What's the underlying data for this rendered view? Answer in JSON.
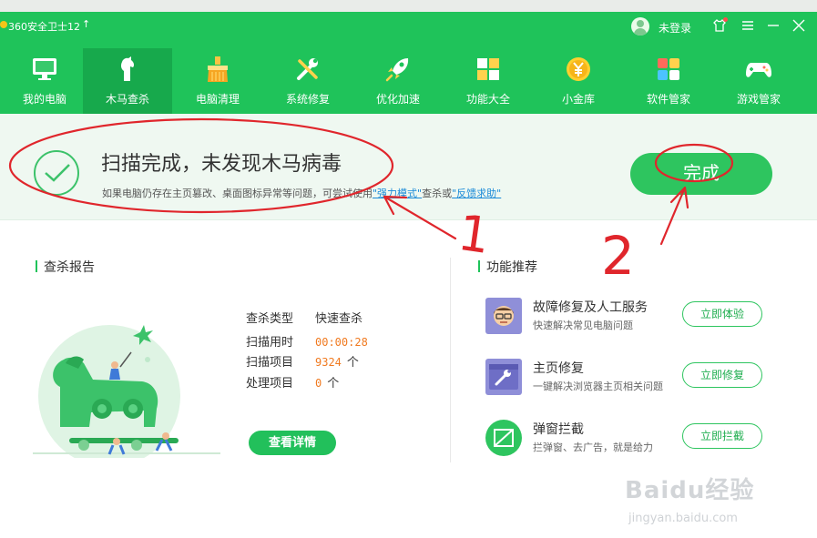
{
  "window": {
    "title": "360安全卫士12",
    "login_label": "未登录"
  },
  "nav": {
    "items": [
      {
        "label": "我的电脑",
        "icon": "monitor-icon"
      },
      {
        "label": "木马查杀",
        "icon": "trojan-horse-icon",
        "active": true
      },
      {
        "label": "电脑清理",
        "icon": "broom-icon"
      },
      {
        "label": "系统修复",
        "icon": "wrench-icon"
      },
      {
        "label": "优化加速",
        "icon": "rocket-icon"
      },
      {
        "label": "功能大全",
        "icon": "grid-icon"
      },
      {
        "label": "小金库",
        "icon": "coin-icon"
      },
      {
        "label": "软件管家",
        "icon": "apps-icon"
      },
      {
        "label": "游戏管家",
        "icon": "gamepad-icon"
      }
    ]
  },
  "result": {
    "title": "扫描完成，未发现木马病毒",
    "sub_prefix": "如果电脑仍存在主页篡改、桌面图标异常等问题，可尝试使用",
    "link1": "\"强力模式\"",
    "sub_mid": "查杀或",
    "link2": "\"反馈求助\"",
    "done_label": "完成"
  },
  "report": {
    "section_title": "查杀报告",
    "rows": [
      {
        "key": "查杀类型",
        "value": "快速查杀",
        "unit": ""
      },
      {
        "key": "扫描用时",
        "value": "00:00:28",
        "unit": ""
      },
      {
        "key": "扫描项目",
        "value": "9324",
        "unit": "个"
      },
      {
        "key": "处理项目",
        "value": "0",
        "unit": "个"
      }
    ],
    "detail_label": "查看详情"
  },
  "features": {
    "section_title": "功能推荐",
    "items": [
      {
        "name": "故障修复及人工服务",
        "desc": "快速解决常见电脑问题",
        "button": "立即体验",
        "icon": "support-person-icon"
      },
      {
        "name": "主页修复",
        "desc": "一键解决浏览器主页相关问题",
        "button": "立即修复",
        "icon": "browser-wrench-icon"
      },
      {
        "name": "弹窗拦截",
        "desc": "拦弹窗、去广告，就是给力",
        "button": "立即拦截",
        "icon": "popup-block-icon"
      }
    ]
  },
  "annotations": {
    "mark1": "1",
    "mark2": "2"
  },
  "watermark": {
    "main": "Baidu经验",
    "url": "jingyan.baidu.com"
  },
  "colors": {
    "brand_green": "#1fc35a",
    "active_tab": "#17a94c",
    "annotation_red": "#e0262c",
    "time_orange": "#f07a20",
    "link_blue": "#1a8ad8"
  }
}
